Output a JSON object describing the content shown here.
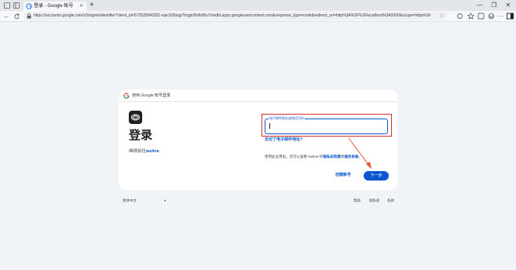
{
  "browser": {
    "tab": {
      "title": "登录 - Google 帐号",
      "close_icon": "✕"
    },
    "new_tab_label": "+",
    "window_controls": [
      "—",
      "❐",
      "✕"
    ],
    "address_bar": {
      "url": "https://accounts.google.com/v3/signin/identifier?client_id=573535945251-vqe1t26sqp7hrgjn36dhd5u7nivdbt.apps.googleusercontent.com&response_type=code&redirect_uri=http%3A%2F%2Flocalhost%3A5000&scope=https%3A%2F%2..."
    }
  },
  "card": {
    "header_text": "使用 Google 帐号登录",
    "title": "登录",
    "subtitle_prefix": "继续前往",
    "subtitle_app": "weline",
    "email_label": "电子邮件地址或电话号码",
    "email_value": "",
    "forgot_link": "忘记了电子邮件地址?",
    "terms_prefix": "使用此应用前，您可以查看\"weline\"的",
    "terms_privacy": "隐私权政策",
    "terms_mid": "和",
    "terms_service": "服务条款",
    "terms_suffix": "。",
    "create_account": "创建帐号",
    "next_button": "下一步"
  },
  "footer": {
    "language": "简体中文",
    "language_caret": "▾",
    "links": [
      "帮助",
      "隐私权",
      "条款"
    ]
  },
  "colors": {
    "accent": "#0b57d0",
    "highlight": "#d93025",
    "arrow": "#e8502a"
  }
}
